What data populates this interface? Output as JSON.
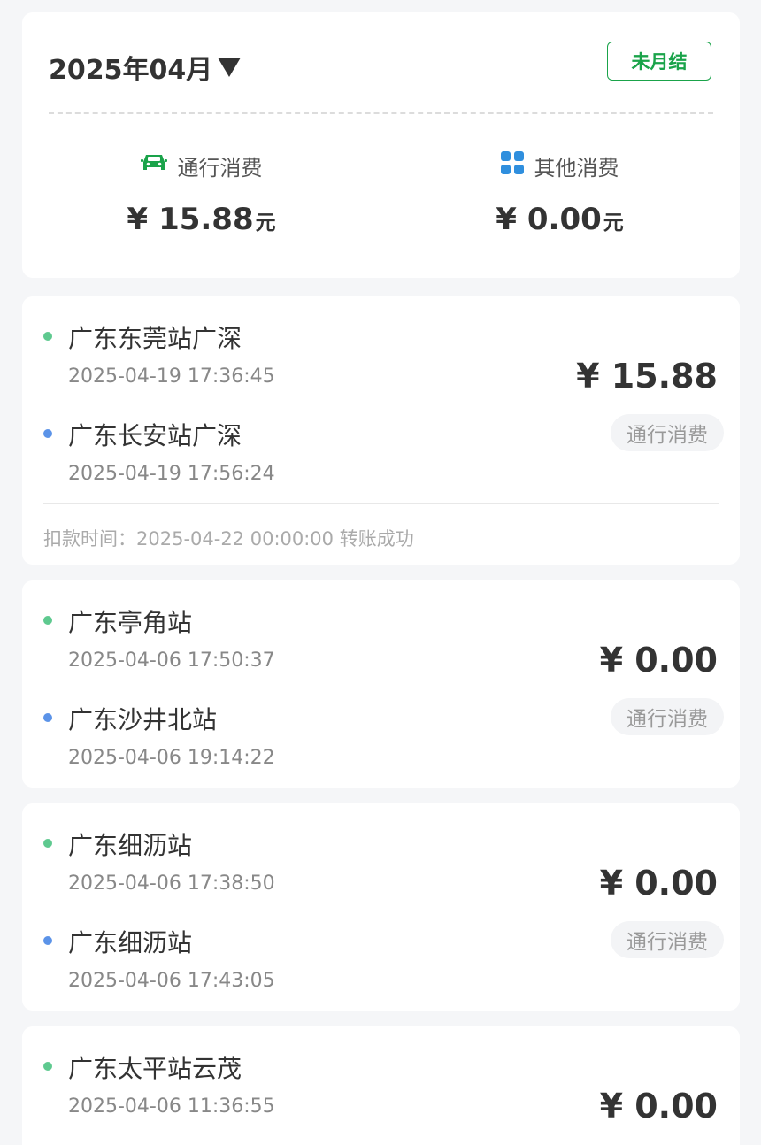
{
  "summary": {
    "month": "2025年04月",
    "status": "未月结",
    "toll": {
      "label": "通行消费",
      "icon": "car-icon",
      "yen": "¥",
      "amount": "15.88",
      "unit": "元",
      "icon_color": "#1aa34a"
    },
    "other": {
      "label": "其他消费",
      "icon": "grid-icon",
      "yen": "¥",
      "amount": "0.00",
      "unit": "元",
      "icon_color": "#2f8fde"
    }
  },
  "transactions": [
    {
      "entry_station": "广东东莞站广深",
      "entry_time": "2025-04-19 17:36:45",
      "exit_station": "广东长安站广深",
      "exit_time": "2025-04-19 17:56:24",
      "amount": "¥ 15.88",
      "type": "通行消费",
      "deduct": "扣款时间：2025-04-22 00:00:00 转账成功"
    },
    {
      "entry_station": "广东亭角站",
      "entry_time": "2025-04-06 17:50:37",
      "exit_station": "广东沙井北站",
      "exit_time": "2025-04-06 19:14:22",
      "amount": "¥ 0.00",
      "type": "通行消费"
    },
    {
      "entry_station": "广东细沥站",
      "entry_time": "2025-04-06 17:38:50",
      "exit_station": "广东细沥站",
      "exit_time": "2025-04-06 17:43:05",
      "amount": "¥ 0.00",
      "type": "通行消费"
    },
    {
      "entry_station": "广东太平站云茂",
      "entry_time": "2025-04-06 11:36:55",
      "amount": "¥ 0.00"
    }
  ],
  "colors": {
    "entry_dot": "#5ec98f",
    "exit_dot": "#5b93e8",
    "accent_green": "#1aa34a"
  }
}
